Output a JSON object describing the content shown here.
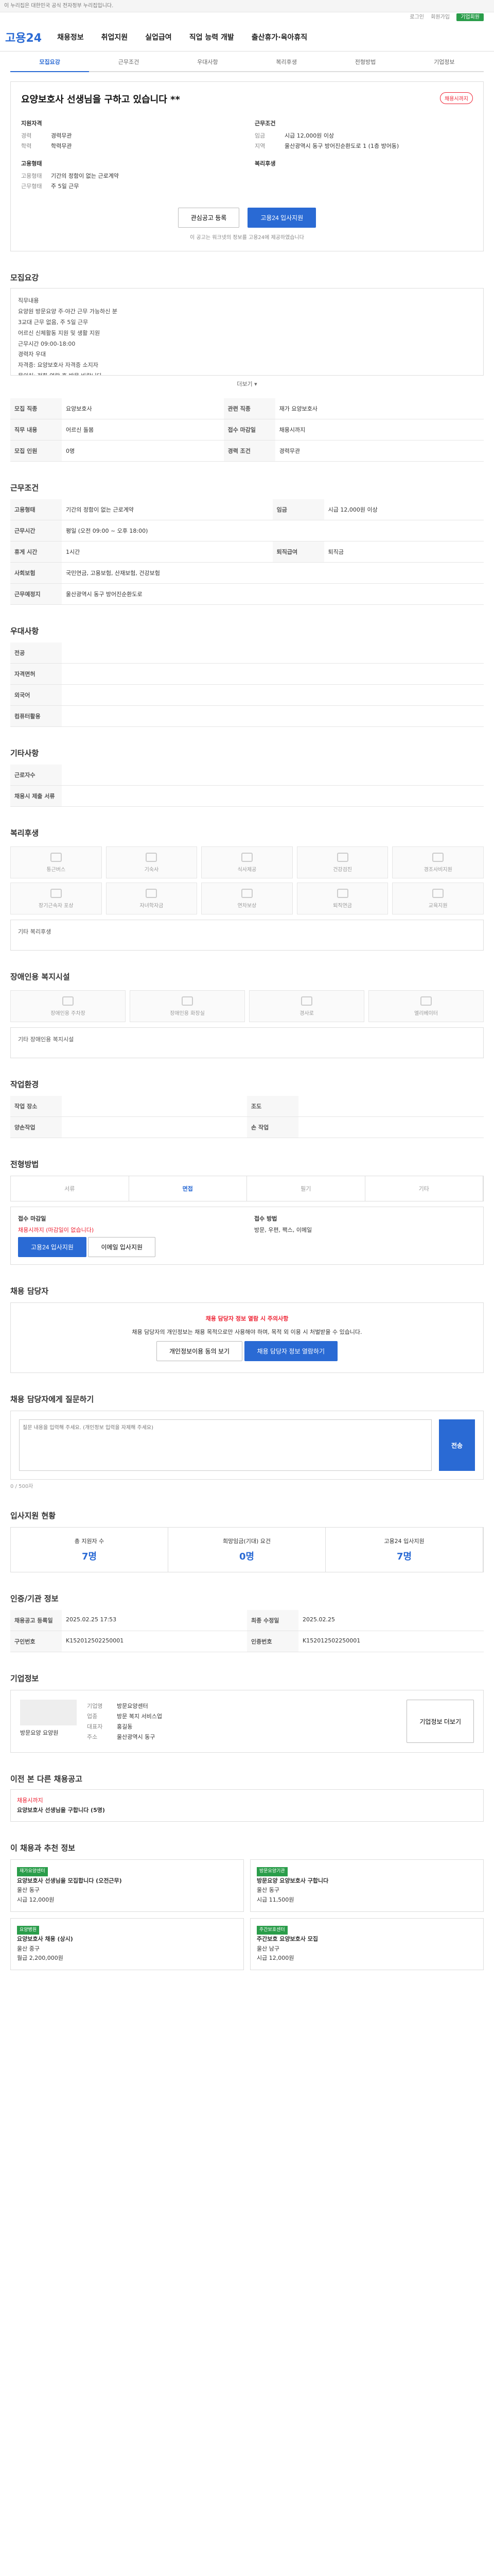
{
  "topbar": "이 누리집은 대한민국 공식 전자정부 누리집입니다.",
  "util": {
    "left": "로그인",
    "right": "회원가입",
    "green": "기업회원"
  },
  "logo": "고용24",
  "nav": [
    "채용정보",
    "취업지원",
    "실업급여",
    "직업 능력 개발",
    "출산휴가·육아휴직"
  ],
  "subtabs": [
    "모집요강",
    "근무조건",
    "우대사항",
    "복리후생",
    "전형방법",
    "기업정보"
  ],
  "job": {
    "title": "요양보호사 선생님을 구하고 있습니다 **",
    "badge": "채용시까지",
    "left_h": "지원자격",
    "left": [
      [
        "경력",
        "경력무관"
      ],
      [
        "학력",
        "학력무관"
      ]
    ],
    "left_h2": "고용형태",
    "left2": [
      [
        "고용형태",
        "기간의 정함이 없는 근로계약"
      ],
      [
        "근무형태",
        "주 5일 근무"
      ]
    ],
    "right_h": "근무조건",
    "right": [
      [
        "임금",
        "시급 12,000원 이상"
      ],
      [
        "지역",
        "울산광역시 동구 방어진순환도로 1 (1층 방어동)"
      ]
    ],
    "right_h2": "복리후생",
    "fav": "관심공고 등록",
    "apply": "고용24 입사지원",
    "notice": "이 공고는 워크넷의 정보를 고용24에 제공하였습니다"
  },
  "recruit": {
    "h": "모집요강",
    "content": [
      "직무내용",
      "요양원 방문요양 주·야간 근무 가능하신 분",
      "3교대 근무 없음, 주 5일 근무",
      "어르신 신체활동 지원 및 생활 지원",
      "근무시간 09:00-18:00",
      "경력자 우대",
      "자격증: 요양보호사 자격증 소지자",
      "문의처: 전화 연락 후 방문 바랍니다"
    ],
    "more": "더보기 ▾",
    "rows": [
      [
        "모집 직종",
        "요양보호사"
      ],
      [
        "관련 직종",
        "재가 요양보호사"
      ],
      [
        "직무 내용",
        "어르신 돌봄"
      ],
      [
        "접수 마감일",
        "채용시까지"
      ],
      [
        "모집 인원",
        "0명"
      ],
      [
        "경력 조건",
        "경력무관"
      ]
    ]
  },
  "cond": {
    "h": "근무조건",
    "rows": [
      [
        "고용형태",
        "기간의 정함이 없는 근로계약"
      ],
      [
        "근무시간",
        "평일 (오전 09:00 ~ 오후 18:00)"
      ],
      [
        "휴게 시간",
        "1시간"
      ],
      [
        "사회보험",
        "국민연금, 고용보험, 산재보험, 건강보험"
      ],
      [
        "근무예정지",
        "울산광역시 동구 방어진순환도로"
      ],
      [
        "임금",
        "시급 12,000원 이상"
      ],
      [
        "퇴직급여",
        "퇴직금"
      ]
    ]
  },
  "pref": {
    "h": "우대사항",
    "rows": [
      [
        "전공",
        ""
      ],
      [
        "자격면허",
        ""
      ],
      [
        "외국어",
        ""
      ],
      [
        "컴퓨터활용",
        ""
      ]
    ]
  },
  "etc": {
    "h": "기타사항",
    "rows": [
      [
        "근로자수",
        ""
      ],
      [
        "채용시 제출 서류",
        ""
      ]
    ]
  },
  "welfare": {
    "h": "복리후생",
    "items": [
      "통근버스",
      "기숙사",
      "식사제공",
      "건강검진",
      "경조사비지원",
      "장기근속자 포상",
      "자녀학자금",
      "연차보상",
      "퇴직연금",
      "교육지원"
    ],
    "etc": "기타 복리후생"
  },
  "disabled": {
    "h": "장애인용 복지시설",
    "items": [
      "장애인용 주차장",
      "장애인용 화장실",
      "경사로",
      "엘리베이터"
    ],
    "etc": "기타 장애인용 복지시설"
  },
  "env": {
    "h": "작업환경",
    "rows": [
      [
        "작업 장소",
        ""
      ],
      [
        "조도",
        ""
      ],
      [
        "양손작업",
        ""
      ],
      [
        "손 작업",
        ""
      ]
    ]
  },
  "method": {
    "h": "전형방법",
    "steps": [
      "서류",
      "면접",
      "필기",
      "기타"
    ],
    "apply_h": "접수 마감일",
    "deadline": "채용시까지 (마감일이 없습니다)",
    "apply_btn": "고용24 입사지원",
    "apply_btn2": "이메일 입사지원",
    "method_h": "접수 방법",
    "method": "방문, 우편, 팩스, 이메일"
  },
  "contact": {
    "h": "채용 담당자",
    "warn": "채용 담당자 정보 열람 시 주의사항",
    "body": "채용 담당자의 개인정보는 채용 목적으로만 사용해야 하며, 목적 외 이용 시 처벌받을 수 있습니다.",
    "btn1": "개인정보이용 동의 보기",
    "btn2": "채용 담당자 정보 열람하기"
  },
  "qa": {
    "h": "채용 담당자에게 질문하기",
    "placeholder": "질문 내용을 입력해 주세요. (개인정보 입력을 자제해 주세요)",
    "count": "0 / 500자",
    "send": "전송"
  },
  "stats": {
    "h": "입사지원 현황",
    "items": [
      [
        "총 지원자 수",
        "7명"
      ],
      [
        "희망임금(기대) 요건",
        "0명"
      ],
      [
        "고용24 입사지원",
        "7명"
      ]
    ]
  },
  "dates": {
    "h": "인증/기관 정보",
    "rows": [
      [
        "채용공고 등록일",
        "2025.02.25 17:53"
      ],
      [
        "구인번호",
        "K152012502250001"
      ],
      [
        "최종 수정일",
        "2025.02.25"
      ],
      [
        "인증번호",
        "K152012502250001"
      ]
    ]
  },
  "company": {
    "h": "기업정보",
    "name": "방문요양 요양원",
    "rows": [
      [
        "기업명",
        "방문요양센터"
      ],
      [
        "업종",
        "방문 복지 서비스업"
      ],
      [
        "대표자",
        "홍길동"
      ],
      [
        "주소",
        "울산광역시 동구"
      ]
    ],
    "btn": "기업정보 더보기"
  },
  "related": {
    "h": "이전 본 다른 채용공고",
    "title": "요양보호사 선생님을 구합니다 (5명)",
    "tag": "채용시까지"
  },
  "reco": {
    "h": "이 채용과 추천 정보",
    "cards": [
      [
        "재가요양센터",
        "요양보호사 선생님을 모집합니다 (오전근무)",
        "울산 동구",
        "시급 12,000원"
      ],
      [
        "방문요양기관",
        "방문요양 요양보호사 구합니다",
        "울산 동구",
        "시급 11,500원"
      ],
      [
        "요양병원",
        "요양보호사 채용 (상시)",
        "울산 중구",
        "월급 2,200,000원"
      ],
      [
        "주간보호센터",
        "주간보호 요양보호사 모집",
        "울산 남구",
        "시급 12,000원"
      ]
    ]
  }
}
